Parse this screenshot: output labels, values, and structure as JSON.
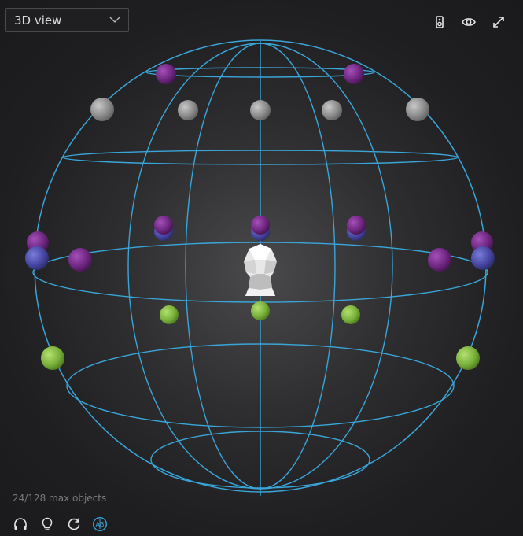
{
  "view_select": {
    "selected": "3D view"
  },
  "status": {
    "objects_text": "24/128 max objects"
  },
  "colors": {
    "wire": "#3aa5d8",
    "gray": "#8a8a8a",
    "purple": "#7a2c8a",
    "blue": "#4a4aa8",
    "green": "#7bb33c",
    "ab_active": "#3aa5d8"
  },
  "toolbar": {
    "icons": [
      "speaker-icon",
      "eye-icon",
      "expand-icon"
    ]
  },
  "bottom_toolbar": {
    "icons": [
      "headphones-icon",
      "lightbulb-icon",
      "refresh-icon",
      "ab-compare-icon"
    ],
    "ab_label": "AB"
  }
}
